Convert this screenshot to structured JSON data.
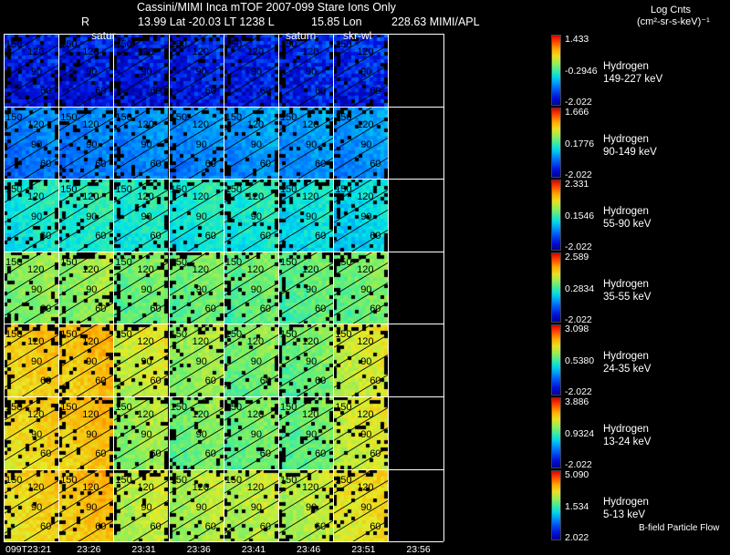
{
  "header": {
    "line1": "Cassini/MIMI Inca mTOF  2007-099   Stare   Ions Only",
    "line2_r": "R",
    "line2_mid": "13.99 Lat -20.03 LT 1238 L",
    "line2_lon": "15.85 Lon",
    "line2_right": "228.63  MIMI/APL",
    "units_title": "Log Cnts",
    "units": "(cm²-sr-s-keV)⁻¹"
  },
  "overlay_labels": {
    "satur": "satur",
    "saturn": "saturn",
    "skr": "skr-wl"
  },
  "times": [
    "099T23:21",
    "23:26",
    "23:31",
    "23:36",
    "23:41",
    "23:46",
    "23:51",
    "23:56"
  ],
  "contour_labels": [
    "150",
    "120",
    "90",
    "60"
  ],
  "footer_note": "B-field Particle Flow",
  "colors": {
    "grid_line": "#ffffff"
  },
  "rows": [
    {
      "species": "Hydrogen",
      "energy": "149-227 keV",
      "max": "1.433",
      "mid": "-0.2946",
      "min": "-2.022",
      "levels": [
        0.12,
        0.12,
        0.11,
        0.13,
        0.12,
        0.14,
        0.14
      ]
    },
    {
      "species": "Hydrogen",
      "energy": "90-149 keV",
      "max": "1.666",
      "mid": "0.1776",
      "min": "-2.022",
      "levels": [
        0.27,
        0.27,
        0.29,
        0.29,
        0.31,
        0.31,
        0.3
      ]
    },
    {
      "species": "Hydrogen",
      "energy": "55-90 keV",
      "max": "2.331",
      "mid": "0.1546",
      "min": "-2.022",
      "levels": [
        0.44,
        0.46,
        0.45,
        0.45,
        0.45,
        0.42,
        0.4
      ]
    },
    {
      "species": "Hydrogen",
      "energy": "35-55 keV",
      "max": "2.589",
      "mid": "0.2834",
      "min": "-2.022",
      "levels": [
        0.58,
        0.59,
        0.55,
        0.55,
        0.54,
        0.53,
        0.55
      ]
    },
    {
      "species": "Hydrogen",
      "energy": "24-35 keV",
      "max": "3.098",
      "mid": "0.5380",
      "min": "-2.022",
      "levels": [
        0.74,
        0.76,
        0.66,
        0.6,
        0.56,
        0.55,
        0.66
      ]
    },
    {
      "species": "Hydrogen",
      "energy": "13-24 keV",
      "max": "3.886",
      "mid": "0.9324",
      "min": "-2.022",
      "levels": [
        0.72,
        0.76,
        0.6,
        0.56,
        0.55,
        0.54,
        0.66
      ]
    },
    {
      "species": "Hydrogen",
      "energy": "5-13 keV",
      "max": "5.090",
      "mid": "1.534",
      "min": "2.022",
      "levels": [
        0.72,
        0.76,
        0.64,
        0.62,
        0.63,
        0.63,
        0.7
      ]
    }
  ]
}
